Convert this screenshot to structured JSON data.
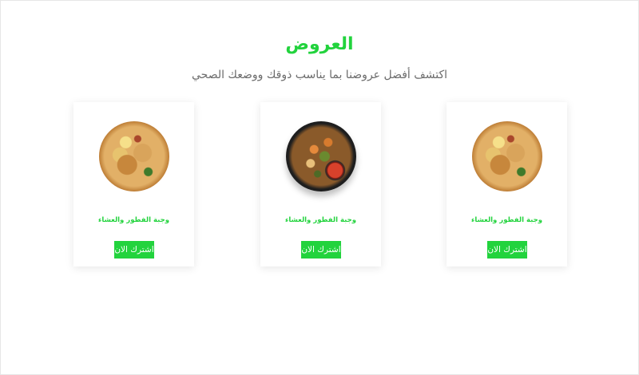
{
  "section": {
    "title": "العروض",
    "subtitle": "اكتشف أفضل عروضنا بما يناسب ذوقك ووضعك الصحي"
  },
  "cards": [
    {
      "name": "وجبة الفطور والعشاء",
      "button_label": "اشترك الان",
      "image": "biryani-dish"
    },
    {
      "name": "وجبة الفطور والعشاء",
      "button_label": "اشترك الان",
      "image": "vegetable-bowl"
    },
    {
      "name": "وجبة الفطور والعشاء",
      "button_label": "اشترك الان",
      "image": "biryani-dish"
    }
  ],
  "colors": {
    "accent": "#22d33d",
    "subtitle": "#6b6b6b",
    "background": "#ffffff"
  }
}
